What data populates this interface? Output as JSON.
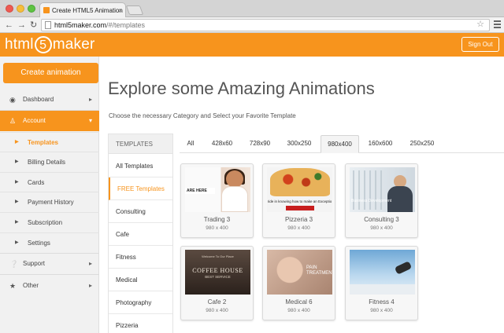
{
  "browser": {
    "tab_title": "Create HTML5 Animation",
    "tab_close": "×",
    "url_host": "html5maker.com",
    "url_path": "/#/templates"
  },
  "header": {
    "logo_before": "html",
    "logo_five": "5",
    "logo_after": "maker",
    "signout_label": "Sign Out",
    "brand_color": "#f7941d"
  },
  "sidebar": {
    "create_label": "Create animation",
    "dashboard": "Dashboard",
    "account": "Account",
    "sub_items": [
      "Templates",
      "Billing Details",
      "Cards",
      "Payment History",
      "Subscription",
      "Settings"
    ],
    "support": "Support",
    "other": "Other"
  },
  "main": {
    "title": "Explore some Amazing Animations",
    "subtitle": "Choose the necessary Category and Select your Favorite Template"
  },
  "categories": {
    "header": "TEMPLATES",
    "items": [
      "All Templates",
      "FREE Templates",
      "Consulting",
      "Cafe",
      "Fitness",
      "Medical",
      "Photography",
      "Pizzeria"
    ]
  },
  "size_tabs": [
    "All",
    "428x60",
    "728x90",
    "300x250",
    "980x400",
    "160x600",
    "250x250"
  ],
  "templates": [
    {
      "name": "Trading 3",
      "size": "980 x 400",
      "thumb_text": "ARE HERE"
    },
    {
      "name": "Pizzeria 3",
      "size": "980 x 400",
      "thumb_text": "ride in knowing how to make an Exceptio"
    },
    {
      "name": "Consulting 3",
      "size": "980 x 400",
      "thumb_text": "Business Development"
    },
    {
      "name": "Cafe 2",
      "size": "980 x 400",
      "thumb_text": "COFFEE HOUSE",
      "thumb_sub": "BEST SERVICE",
      "thumb_top": "Welcome To Our Place"
    },
    {
      "name": "Medical 6",
      "size": "980 x 400",
      "thumb_text": "PAIN TREATMENT"
    },
    {
      "name": "Fitness 4",
      "size": "980 x 400"
    }
  ]
}
